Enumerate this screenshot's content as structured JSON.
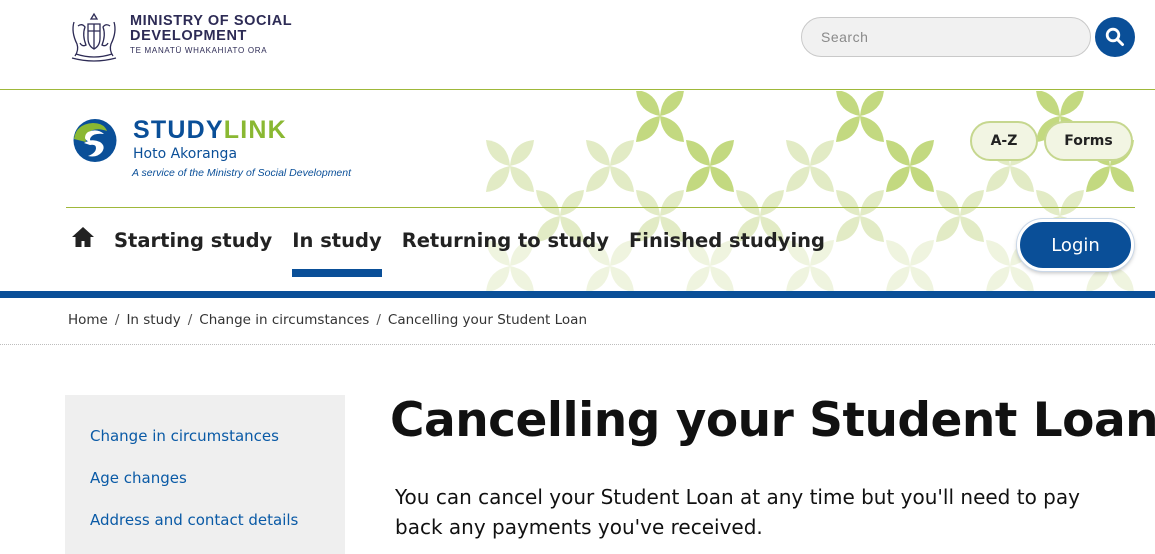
{
  "msd": {
    "name": "MINISTRY OF SOCIAL DEVELOPMENT",
    "maori_name": "TE MANATŪ WHAKAHIATO ORA"
  },
  "search": {
    "placeholder": "Search",
    "value": ""
  },
  "studylink": {
    "word_study": "STUDY",
    "word_link": "LINK",
    "maori_name": "Hoto Akoranga",
    "tagline": "A service of the Ministry of Social Development",
    "colors": {
      "blue": "#0a4f98",
      "green": "#8ab832"
    }
  },
  "quick_links": {
    "az_label": "A-Z",
    "forms_label": "Forms"
  },
  "nav": {
    "items": [
      {
        "label": "Starting study",
        "active": false
      },
      {
        "label": "In study",
        "active": true
      },
      {
        "label": "Returning to study",
        "active": false
      },
      {
        "label": "Finished studying",
        "active": false
      }
    ],
    "login_label": "Login"
  },
  "breadcrumb": {
    "items": [
      "Home",
      "In study",
      "Change in circumstances",
      "Cancelling your Student Loan"
    ],
    "separator": "/"
  },
  "sidebar": {
    "items": [
      {
        "label": "Change in circumstances"
      },
      {
        "label": "Age changes"
      },
      {
        "label": "Address and contact details"
      }
    ]
  },
  "main": {
    "title": "Cancelling your Student Loan",
    "intro": "You can cancel your Student Loan at any time but you'll need to pay back any payments you've received."
  }
}
